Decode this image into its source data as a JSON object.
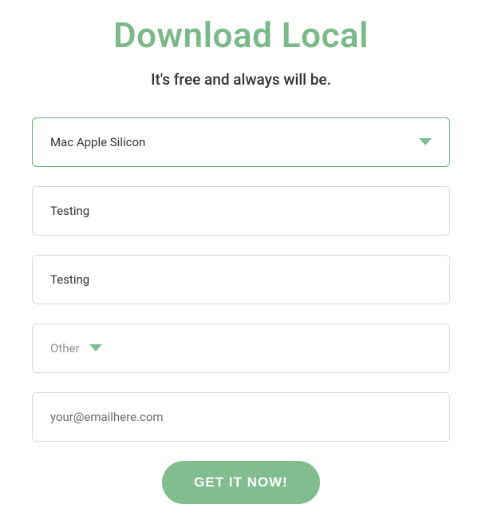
{
  "header": {
    "title": "Download Local",
    "subtitle": "It's free and always will be."
  },
  "form": {
    "platform_select": {
      "value": "Mac Apple Silicon"
    },
    "first_name": {
      "value": "Testing"
    },
    "last_name": {
      "value": "Testing"
    },
    "reason_select": {
      "value": "Other"
    },
    "email": {
      "value": "",
      "placeholder": "your@emailhere.com"
    },
    "submit_label": "GET IT NOW!"
  },
  "colors": {
    "accent": "#7bb98b"
  }
}
